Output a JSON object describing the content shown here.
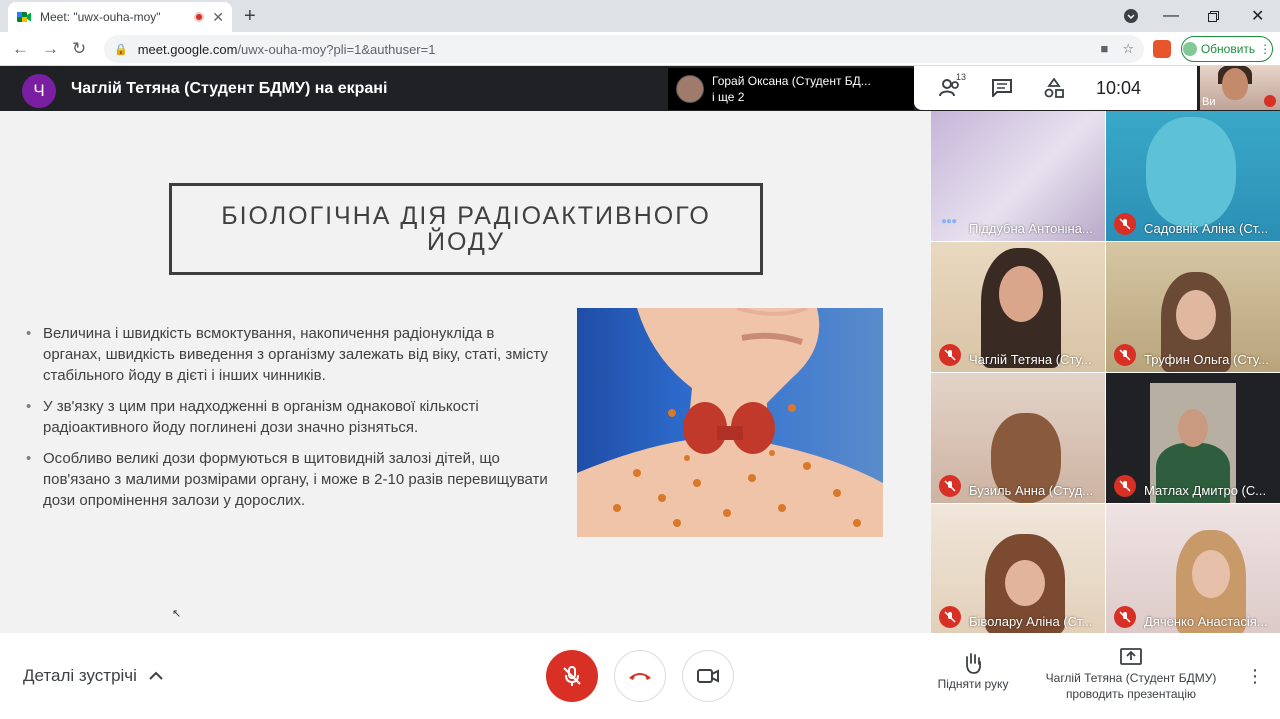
{
  "browser": {
    "tab_title": "Meet: \"uwx-ouha-moy\"",
    "url_host": "meet.google.com",
    "url_path": "/uwx-ouha-moy?pli=1&authuser=1",
    "update_label": "Обновить"
  },
  "header": {
    "presenter_initial": "Ч",
    "presenter_title": "Чаглій Тетяна (Студент БДМУ) на екрані",
    "speaker_name": "Горай Оксана (Студент БД...",
    "speaker_more": "і ще 2",
    "participants_count": "13",
    "clock": "10:04",
    "self_label": "Ви"
  },
  "slide": {
    "title": "БІОЛОГІЧНА ДІЯ РАДІОАКТИВНОГО ЙОДУ",
    "bullets": [
      "Величина і швидкість всмоктування, накопичення радіонукліда в органах, швидкість виведення з організму залежать від віку, статі, змісту стабільного йоду в дієті і інших чинників.",
      "У зв'язку з цим при надходженні в організм однакової кількості радіоактивного йоду поглинені дози значно різняться.",
      "Особливо великі дози формуються в щитовидній залозі дітей, що пов'язано з малими розмірами органу, і може в 2-10 разів перевищувати дози опромінення залози у дорослих."
    ]
  },
  "participants": [
    {
      "name": "Піддубна Антоніна...",
      "muted": false
    },
    {
      "name": "Садовнік Аліна (Ст...",
      "muted": true
    },
    {
      "name": "Чаглій Тетяна (Сту...",
      "muted": true
    },
    {
      "name": "Труфин Ольга (Сту...",
      "muted": true
    },
    {
      "name": "Бузиль Анна (Студ...",
      "muted": true
    },
    {
      "name": "Матлах Дмитро (С...",
      "muted": true
    },
    {
      "name": "Біволару Аліна (Ст...",
      "muted": true
    },
    {
      "name": "Дяченко Анастасія...",
      "muted": true
    }
  ],
  "bottom": {
    "details_label": "Деталі зустрічі",
    "raise_hand_label": "Підняти руку",
    "presenting_label_1": "Чаглій Тетяна (Студент БДМУ)",
    "presenting_label_2": "проводить презентацію"
  },
  "colors": {
    "meet_red": "#d93025",
    "presenter_avatar": "#7b1fa2",
    "header_bg": "#202124"
  }
}
